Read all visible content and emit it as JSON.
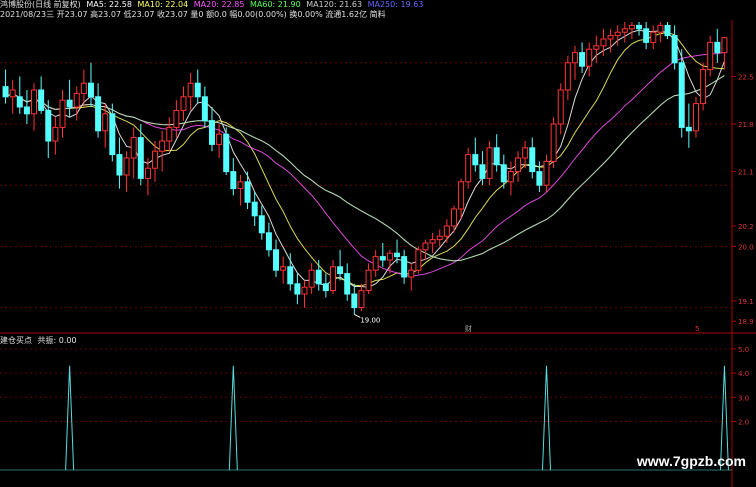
{
  "header": {
    "stock_name": "鸿博股份(日线 前复权)",
    "ma": [
      {
        "label": "MA5: 22.58",
        "color": "#ffffff"
      },
      {
        "label": "MA10: 22.04",
        "color": "#ffff66"
      },
      {
        "label": "MA20: 22.85",
        "color": "#ff55ff"
      },
      {
        "label": "MA60: 21.90",
        "color": "#55ff55"
      },
      {
        "label": "MA120: 21.63",
        "color": "#cccccc"
      },
      {
        "label": "MA250: 19.63",
        "color": "#6666ff"
      }
    ],
    "bar_info": "2021/08/23三 开23.07 高23.07 低23.07 收23.07 量0 额0.0 幅0.00(0.00%) 换0.00% 流通1.62亿 简料"
  },
  "indicator": {
    "title": "建仓买点",
    "value_label": "共振: 0.00",
    "color": "#55dddd"
  },
  "watermark": "www.7gpzb.com",
  "chart_data": [
    {
      "type": "candlestick",
      "name": "price",
      "ylim": [
        18.8,
        23.3
      ],
      "y_ticks": [
        "22.5",
        "21.8",
        "21.1",
        "20.2",
        "20.0",
        "19.1",
        "18.9"
      ],
      "low_annotation": "19.00",
      "markers": [
        "财",
        "5"
      ],
      "ohlc": [
        [
          22.35,
          22.6,
          22.1,
          22.2
        ],
        [
          22.2,
          22.45,
          21.95,
          22.3
        ],
        [
          22.2,
          22.5,
          21.95,
          22.05
        ],
        [
          22.05,
          22.3,
          21.8,
          21.95
        ],
        [
          21.95,
          22.4,
          21.7,
          22.3
        ],
        [
          22.3,
          22.5,
          21.95,
          22.0
        ],
        [
          22.0,
          22.15,
          21.3,
          21.55
        ],
        [
          21.55,
          21.9,
          21.35,
          21.75
        ],
        [
          21.75,
          22.3,
          21.6,
          22.15
        ],
        [
          22.15,
          22.45,
          21.9,
          22.05
        ],
        [
          22.05,
          22.35,
          21.85,
          22.25
        ],
        [
          22.25,
          22.6,
          22.05,
          22.4
        ],
        [
          22.4,
          22.7,
          22.05,
          22.2
        ],
        [
          22.2,
          22.4,
          21.6,
          21.7
        ],
        [
          21.7,
          22.1,
          21.45,
          21.95
        ],
        [
          21.95,
          22.1,
          21.25,
          21.35
        ],
        [
          21.35,
          21.6,
          20.85,
          21.05
        ],
        [
          21.05,
          21.4,
          20.8,
          21.3
        ],
        [
          21.3,
          21.75,
          21.0,
          21.6
        ],
        [
          21.6,
          21.8,
          20.9,
          21.0
        ],
        [
          21.0,
          21.3,
          20.75,
          21.15
        ],
        [
          21.15,
          21.55,
          20.95,
          21.4
        ],
        [
          21.4,
          21.7,
          21.1,
          21.55
        ],
        [
          21.55,
          21.9,
          21.4,
          21.75
        ],
        [
          21.75,
          22.15,
          21.6,
          22.0
        ],
        [
          22.0,
          22.35,
          21.85,
          22.2
        ],
        [
          22.2,
          22.55,
          22.0,
          22.4
        ],
        [
          22.4,
          22.6,
          22.1,
          22.2
        ],
        [
          22.2,
          22.35,
          21.75,
          21.85
        ],
        [
          21.85,
          22.05,
          21.4,
          21.5
        ],
        [
          21.5,
          21.8,
          21.3,
          21.65
        ],
        [
          21.65,
          21.75,
          21.05,
          21.1
        ],
        [
          21.1,
          21.3,
          20.75,
          20.85
        ],
        [
          20.85,
          21.05,
          20.6,
          20.95
        ],
        [
          20.95,
          21.1,
          20.55,
          20.65
        ],
        [
          20.65,
          20.8,
          20.3,
          20.45
        ],
        [
          20.45,
          20.6,
          20.1,
          20.2
        ],
        [
          20.2,
          20.35,
          19.85,
          19.95
        ],
        [
          19.95,
          20.1,
          19.55,
          19.65
        ],
        [
          19.65,
          19.85,
          19.45,
          19.7
        ],
        [
          19.7,
          19.9,
          19.35,
          19.45
        ],
        [
          19.45,
          19.6,
          19.15,
          19.3
        ],
        [
          19.3,
          19.5,
          19.1,
          19.4
        ],
        [
          19.4,
          19.75,
          19.3,
          19.65
        ],
        [
          19.65,
          19.8,
          19.35,
          19.45
        ],
        [
          19.45,
          19.6,
          19.25,
          19.35
        ],
        [
          19.35,
          19.8,
          19.3,
          19.7
        ],
        [
          19.7,
          19.95,
          19.5,
          19.6
        ],
        [
          19.6,
          19.75,
          19.2,
          19.3
        ],
        [
          19.3,
          19.45,
          19.0,
          19.1
        ],
        [
          19.1,
          19.45,
          19.05,
          19.35
        ],
        [
          19.35,
          19.75,
          19.3,
          19.65
        ],
        [
          19.65,
          19.95,
          19.55,
          19.85
        ],
        [
          19.85,
          20.05,
          19.7,
          19.8
        ],
        [
          19.8,
          19.95,
          19.6,
          19.9
        ],
        [
          19.9,
          20.1,
          19.75,
          19.85
        ],
        [
          19.85,
          19.95,
          19.45,
          19.55
        ],
        [
          19.55,
          19.75,
          19.35,
          19.65
        ],
        [
          19.65,
          20.0,
          19.6,
          19.95
        ],
        [
          19.95,
          20.1,
          19.8,
          20.05
        ],
        [
          20.05,
          20.2,
          19.9,
          20.1
        ],
        [
          20.1,
          20.25,
          20.0,
          20.15
        ],
        [
          20.15,
          20.4,
          20.05,
          20.3
        ],
        [
          20.3,
          20.6,
          20.2,
          20.55
        ],
        [
          20.55,
          21.0,
          20.4,
          20.95
        ],
        [
          20.95,
          21.45,
          20.85,
          21.35
        ],
        [
          21.35,
          21.6,
          21.1,
          21.2
        ],
        [
          21.2,
          21.4,
          20.9,
          21.0
        ],
        [
          21.0,
          21.55,
          20.9,
          21.45
        ],
        [
          21.45,
          21.65,
          21.1,
          21.2
        ],
        [
          21.2,
          21.35,
          20.85,
          20.95
        ],
        [
          20.95,
          21.25,
          20.75,
          21.1
        ],
        [
          21.1,
          21.4,
          20.95,
          21.3
        ],
        [
          21.3,
          21.55,
          21.15,
          21.45
        ],
        [
          21.45,
          21.6,
          21.0,
          21.1
        ],
        [
          21.1,
          21.25,
          20.8,
          20.9
        ],
        [
          20.9,
          21.35,
          20.8,
          21.25
        ],
        [
          21.25,
          21.9,
          21.15,
          21.8
        ],
        [
          21.8,
          22.4,
          21.65,
          22.3
        ],
        [
          22.3,
          22.8,
          22.15,
          22.7
        ],
        [
          22.7,
          22.95,
          22.45,
          22.85
        ],
        [
          22.85,
          23.0,
          22.55,
          22.65
        ],
        [
          22.65,
          23.0,
          22.5,
          22.9
        ],
        [
          22.9,
          23.1,
          22.7,
          22.95
        ],
        [
          22.95,
          23.2,
          22.8,
          23.05
        ],
        [
          23.05,
          23.2,
          22.85,
          23.1
        ],
        [
          23.1,
          23.25,
          22.95,
          23.15
        ],
        [
          23.15,
          23.3,
          23.0,
          23.2
        ],
        [
          23.2,
          23.3,
          23.05,
          23.25
        ],
        [
          23.25,
          23.3,
          23.1,
          23.2
        ],
        [
          23.2,
          23.3,
          22.9,
          23.0
        ],
        [
          23.0,
          23.25,
          22.9,
          23.15
        ],
        [
          23.15,
          23.3,
          23.0,
          23.25
        ],
        [
          23.25,
          23.3,
          23.05,
          23.1
        ],
        [
          23.1,
          23.25,
          22.6,
          22.7
        ],
        [
          22.7,
          22.9,
          21.6,
          21.75
        ],
        [
          21.75,
          22.1,
          21.45,
          21.7
        ],
        [
          21.7,
          22.2,
          21.6,
          22.1
        ],
        [
          22.1,
          22.7,
          22.0,
          22.6
        ],
        [
          22.6,
          23.1,
          22.5,
          23.0
        ],
        [
          23.0,
          23.2,
          22.7,
          22.85
        ],
        [
          22.85,
          23.07,
          22.6,
          23.07
        ]
      ],
      "moving_averages": [
        {
          "name": "MA5",
          "color": "#ffffff",
          "period": 5
        },
        {
          "name": "MA10",
          "color": "#ffff66",
          "period": 10
        },
        {
          "name": "MA20",
          "color": "#ff55ff",
          "period": 20
        },
        {
          "name": "MA60",
          "color": "#55ff55",
          "period": 60
        },
        {
          "name": "MA120",
          "color": "#cccccc",
          "period": 120
        }
      ],
      "up_color": "#ff3333",
      "down_color": "#55ffff"
    },
    {
      "type": "line",
      "name": "indicator",
      "ylim": [
        0,
        5.2
      ],
      "y_ticks": [
        "5.0",
        "4.0",
        "3.0",
        "2.0"
      ],
      "spikes": [
        {
          "index": 9,
          "value": 4.3
        },
        {
          "index": 32,
          "value": 4.3
        },
        {
          "index": 76,
          "value": 4.3
        },
        {
          "index": 101,
          "value": 4.3
        }
      ]
    }
  ]
}
